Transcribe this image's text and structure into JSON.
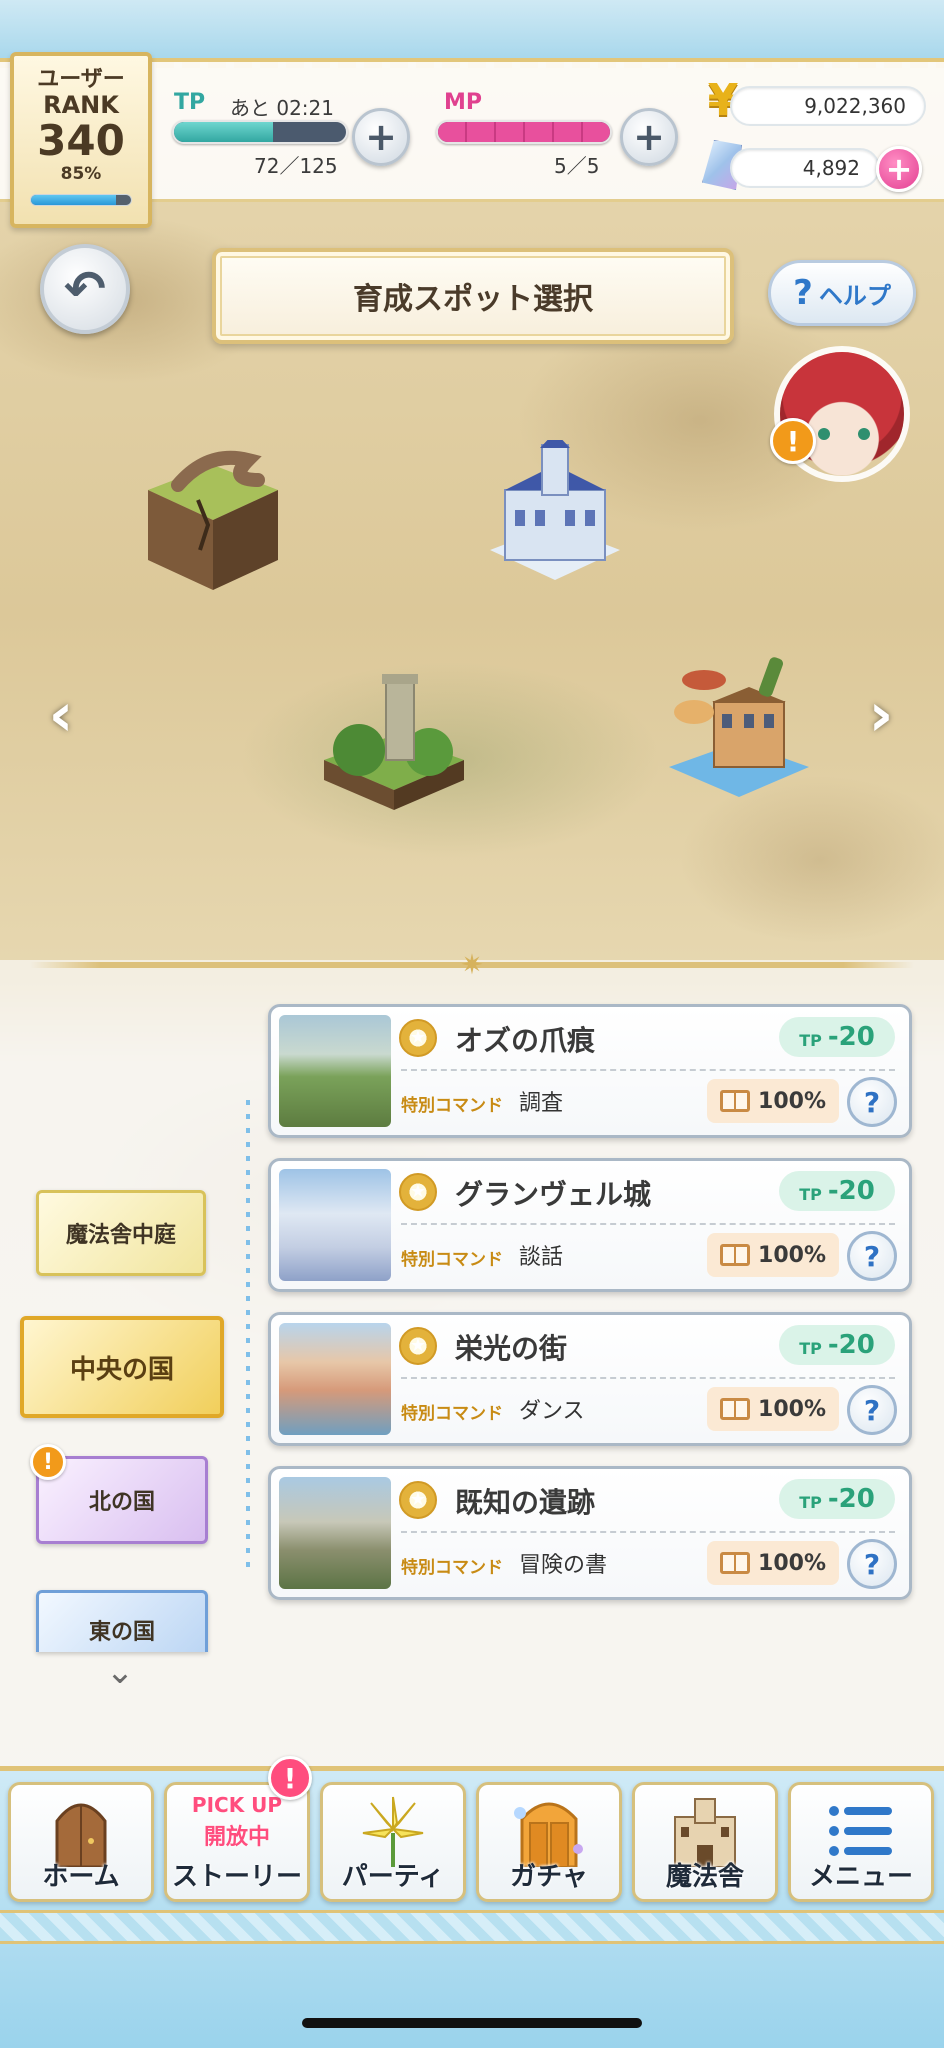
{
  "rank": {
    "line1": "ユーザー",
    "line2": "RANK",
    "value": "340",
    "percent_text": "85%",
    "progress": 0.85
  },
  "tp": {
    "label": "TP",
    "timer": "あと 02:21",
    "current": "72／125",
    "fill": 0.576
  },
  "mp": {
    "label": "MP",
    "current": "5／5",
    "fill": 1.0
  },
  "currency": {
    "money": "9,022,360",
    "crystals": "4,892"
  },
  "page_title": "育成スポット選択",
  "help": {
    "q": "?",
    "label": "ヘルプ"
  },
  "alerts": {
    "char": "!",
    "north": "!",
    "story": "!"
  },
  "regions": [
    {
      "label": "魔法舎中庭"
    },
    {
      "label": "中央の国"
    },
    {
      "label": "北の国"
    },
    {
      "label": "東の国"
    }
  ],
  "spots": [
    {
      "name": "オズの爪痕",
      "tp_label": "TP",
      "tp": "-20",
      "cmd_label": "特別コマンド",
      "cmd": "調査",
      "rate": "100%"
    },
    {
      "name": "グランヴェル城",
      "tp_label": "TP",
      "tp": "-20",
      "cmd_label": "特別コマンド",
      "cmd": "談話",
      "rate": "100%"
    },
    {
      "name": "栄光の街",
      "tp_label": "TP",
      "tp": "-20",
      "cmd_label": "特別コマンド",
      "cmd": "ダンス",
      "rate": "100%"
    },
    {
      "name": "既知の遺跡",
      "tp_label": "TP",
      "tp": "-20",
      "cmd_label": "特別コマンド",
      "cmd": "冒険の書",
      "rate": "100%"
    }
  ],
  "nav": {
    "home": "ホーム",
    "story_badge1": "PICK UP",
    "story_badge2": "開放中",
    "story": "ストーリー",
    "party": "パーティ",
    "gacha": "ガチャ",
    "mahousha": "魔法舎",
    "menu": "メニュー"
  },
  "colors": {
    "tp": "#32a7a1",
    "mp": "#e8509d",
    "accent_gold": "#dcc07a",
    "help_blue": "#2f78c9"
  }
}
